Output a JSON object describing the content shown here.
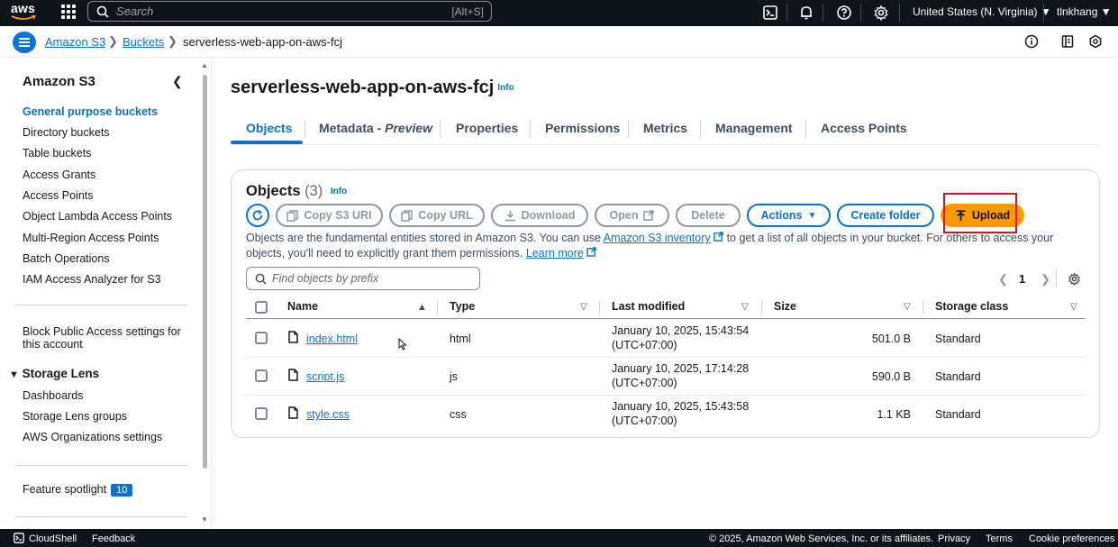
{
  "topnav": {
    "logo": "aws",
    "search_placeholder": "Search",
    "search_shortcut": "[Alt+S]",
    "region": "United States (N. Virginia) ▼",
    "user": "tlnkhang ▼"
  },
  "breadcrumb": {
    "items": [
      "Amazon S3",
      "Buckets",
      "serverless-web-app-on-aws-fcj"
    ]
  },
  "sidebar": {
    "title": "Amazon S3",
    "items": [
      "General purpose buckets",
      "Directory buckets",
      "Table buckets",
      "Access Grants",
      "Access Points",
      "Object Lambda Access Points",
      "Multi-Region Access Points",
      "Batch Operations",
      "IAM Access Analyzer for S3"
    ],
    "block_public_line1": "Block Public Access settings for",
    "block_public_line2": "this account",
    "storage_lens_title": "Storage Lens",
    "storage_lens_items": [
      "Dashboards",
      "Storage Lens groups",
      "AWS Organizations settings"
    ],
    "feature_spotlight": "Feature spotlight",
    "feature_spotlight_count": "10"
  },
  "main": {
    "title": "serverless-web-app-on-aws-fcj",
    "info": "Info",
    "tabs": {
      "objects": "Objects",
      "metadata": "Metadata - ",
      "metadata_preview": "Preview",
      "properties": "Properties",
      "permissions": "Permissions",
      "metrics": "Metrics",
      "management": "Management",
      "access_points": "Access Points"
    }
  },
  "objects": {
    "title": "Objects",
    "count": "(3)",
    "info": "Info",
    "buttons": {
      "copy_s3_uri": "Copy S3 URI",
      "copy_url": "Copy URL",
      "download": "Download",
      "open": "Open",
      "delete": "Delete",
      "actions": "Actions",
      "create_folder": "Create folder",
      "upload": "Upload"
    },
    "description_part1": "Objects are the fundamental entities stored in Amazon S3. You can use ",
    "description_link1": "Amazon S3 inventory",
    "description_part2": " to get a list of all objects in your bucket. For others to access your objects, you'll need to explicitly grant them permissions. ",
    "description_link2": "Learn more",
    "filter_placeholder": "Find objects by prefix",
    "page": "1",
    "columns": {
      "name": "Name",
      "type": "Type",
      "last_modified": "Last modified",
      "size": "Size",
      "storage_class": "Storage class"
    },
    "rows": [
      {
        "name": "index.html",
        "type": "html",
        "modified_1": "January 10, 2025, 15:43:54",
        "modified_2": "(UTC+07:00)",
        "size": "501.0 B",
        "storage": "Standard"
      },
      {
        "name": "script.js",
        "type": "js",
        "modified_1": "January 10, 2025, 17:14:28",
        "modified_2": "(UTC+07:00)",
        "size": "590.0 B",
        "storage": "Standard"
      },
      {
        "name": "style.css",
        "type": "css",
        "modified_1": "January 10, 2025, 15:43:58",
        "modified_2": "(UTC+07:00)",
        "size": "1.1 KB",
        "storage": "Standard"
      }
    ]
  },
  "footer": {
    "cloudshell": "CloudShell",
    "feedback": "Feedback",
    "copyright": "© 2025, Amazon Web Services, Inc. or its affiliates.",
    "privacy": "Privacy",
    "terms": "Terms",
    "cookie": "Cookie preferences"
  }
}
